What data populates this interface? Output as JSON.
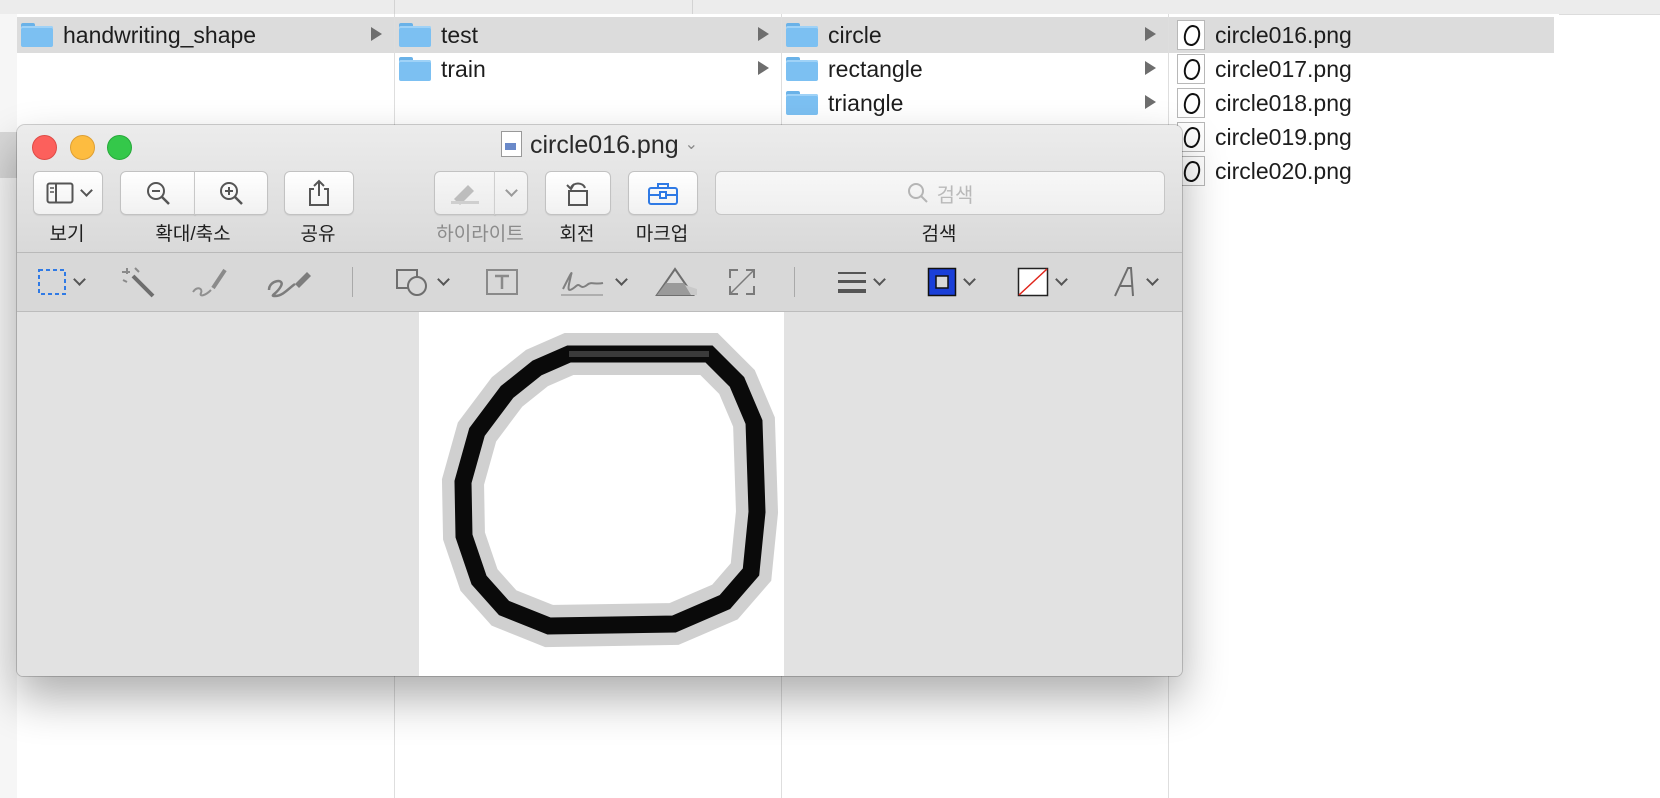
{
  "finder": {
    "columns": [
      {
        "items": [
          {
            "name": "handwriting_shape",
            "type": "folder",
            "selected": true
          }
        ]
      },
      {
        "items": [
          {
            "name": "test",
            "type": "folder",
            "selected": true
          },
          {
            "name": "train",
            "type": "folder",
            "selected": false
          }
        ]
      },
      {
        "items": [
          {
            "name": "circle",
            "type": "folder",
            "selected": true
          },
          {
            "name": "rectangle",
            "type": "folder",
            "selected": false
          },
          {
            "name": "triangle",
            "type": "folder",
            "selected": false
          }
        ]
      },
      {
        "items": [
          {
            "name": "circle016.png",
            "type": "image",
            "selected": true
          },
          {
            "name": "circle017.png",
            "type": "image",
            "selected": false
          },
          {
            "name": "circle018.png",
            "type": "image",
            "selected": false
          },
          {
            "name": "circle019.png",
            "type": "image",
            "selected": false
          },
          {
            "name": "circle020.png",
            "type": "image",
            "selected": false
          }
        ]
      }
    ]
  },
  "preview": {
    "title": "circle016.png",
    "toolbar": {
      "view_label": "보기",
      "zoom_label": "확대/축소",
      "share_label": "공유",
      "highlight_label": "하이라이트",
      "rotate_label": "회전",
      "markup_label": "마크업",
      "search_label": "검색",
      "search_placeholder": "검색"
    },
    "markup_tools": [
      "rect-select-icon",
      "instant-alpha-icon",
      "sketch-icon",
      "draw-icon",
      "shapes-icon",
      "text-icon",
      "sign-icon",
      "adjust-color-icon",
      "adjust-size-icon",
      "shape-style-icon",
      "border-color-icon",
      "fill-color-icon",
      "text-style-icon"
    ],
    "colors": {
      "border_color": "#1a3fd8",
      "fill_none_slash": "#e0241a",
      "markup_accent": "#2f7ae5"
    }
  }
}
